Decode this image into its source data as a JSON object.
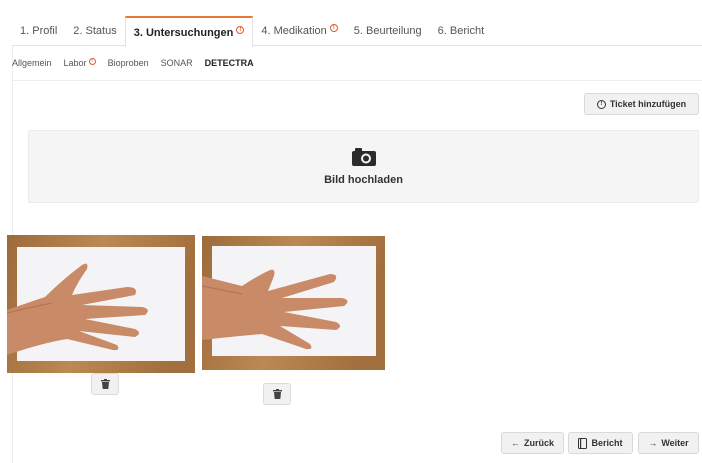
{
  "main_tabs": [
    {
      "label": "1. Profil",
      "warning": false,
      "active": false
    },
    {
      "label": "2. Status",
      "warning": false,
      "active": false
    },
    {
      "label": "3. Untersuchungen",
      "warning": true,
      "active": true
    },
    {
      "label": "4. Medikation",
      "warning": true,
      "active": false
    },
    {
      "label": "5. Beurteilung",
      "warning": false,
      "active": false
    },
    {
      "label": "6. Bericht",
      "warning": false,
      "active": false
    }
  ],
  "sub_tabs": [
    {
      "label": "Allgemein",
      "warning": false,
      "active": false
    },
    {
      "label": "Labor",
      "warning": true,
      "active": false
    },
    {
      "label": "Bioproben",
      "warning": false,
      "active": false
    },
    {
      "label": "SONAR",
      "warning": false,
      "active": false
    },
    {
      "label": "DETECTRA",
      "warning": false,
      "active": true
    }
  ],
  "toolbar": {
    "ticket_label": "Ticket hinzufügen"
  },
  "upload": {
    "label": "Bild hochladen",
    "icon": "camera-icon"
  },
  "photos": [
    {
      "name": "hand-photo-1",
      "icon": "trash-icon"
    },
    {
      "name": "hand-photo-2",
      "icon": "trash-icon"
    }
  ],
  "footer": {
    "back_label": "Zurück",
    "report_label": "Bericht",
    "next_label": "Weiter"
  },
  "colors": {
    "accent": "#e8773a",
    "warning": "#e05a2b",
    "wood": "#b07a45",
    "paper": "#f4f4f7",
    "skin": "#c98a68"
  }
}
